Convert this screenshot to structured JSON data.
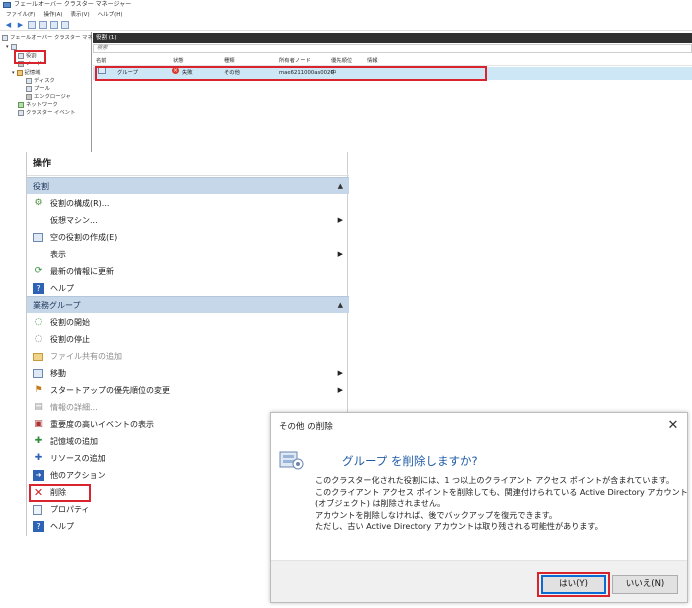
{
  "window": {
    "title": "フェールオーバー クラスター マネージャー",
    "menu": [
      "ファイル(F)",
      "操作(A)",
      "表示(V)",
      "ヘルプ(H)"
    ]
  },
  "tree": {
    "root": "フェールオーバー クラスター マネージャー",
    "cluster": "",
    "items": [
      "役割",
      "ノード",
      "記憶域",
      "ディスク",
      "プール",
      "エンクロージャ",
      "ネットワーク",
      "クラスター イベント"
    ]
  },
  "roles_pane": {
    "header": "役割 (1)",
    "search_placeholder": "検索",
    "columns": [
      "名前",
      "状態",
      "種類",
      "所有者ノード",
      "優先順位",
      "情報"
    ],
    "rows": [
      {
        "name": "グループ",
        "status": "失敗",
        "type": "その他",
        "owner": "mae6211000as0020",
        "priority": "中",
        "info": ""
      }
    ]
  },
  "actions_panel": {
    "title": "操作",
    "section_roles": "役割",
    "roles_items": [
      {
        "icon": "configure-role-icon",
        "label": "役割の構成(R)...",
        "submenu": false,
        "disabled": false
      },
      {
        "icon": "",
        "label": "仮想マシン...",
        "submenu": true,
        "disabled": false
      },
      {
        "icon": "empty-role-icon",
        "label": "空の役割の作成(E)",
        "submenu": false,
        "disabled": false
      },
      {
        "icon": "",
        "label": "表示",
        "submenu": true,
        "disabled": false
      },
      {
        "icon": "refresh-icon",
        "label": "最新の情報に更新",
        "submenu": false,
        "disabled": false
      },
      {
        "icon": "help-icon",
        "label": "ヘルプ",
        "submenu": false,
        "disabled": false
      }
    ],
    "section_group": "業務グループ",
    "group_items": [
      {
        "icon": "start-role-icon",
        "label": "役割の開始",
        "submenu": false,
        "disabled": false
      },
      {
        "icon": "stop-role-icon",
        "label": "役割の停止",
        "submenu": false,
        "disabled": false
      },
      {
        "icon": "file-share-icon",
        "label": "ファイル共有の追加",
        "submenu": false,
        "disabled": true
      },
      {
        "icon": "move-icon",
        "label": "移動",
        "submenu": true,
        "disabled": false
      },
      {
        "icon": "startup-priority-icon",
        "label": "スタートアップの優先順位の変更",
        "submenu": true,
        "disabled": false
      },
      {
        "icon": "info-icon",
        "label": "情報の詳細...",
        "submenu": false,
        "disabled": true
      },
      {
        "icon": "critical-events-icon",
        "label": "重要度の高いイベントの表示",
        "submenu": false,
        "disabled": false
      },
      {
        "icon": "add-storage-icon",
        "label": "記憶域の追加",
        "submenu": false,
        "disabled": false
      },
      {
        "icon": "add-resource-icon",
        "label": "リソースの追加",
        "submenu": true,
        "disabled": false
      },
      {
        "icon": "more-actions-icon",
        "label": "他のアクション",
        "submenu": true,
        "disabled": false
      },
      {
        "icon": "delete-icon",
        "label": "削除",
        "submenu": false,
        "disabled": false
      },
      {
        "icon": "properties-icon",
        "label": "プロパティ",
        "submenu": false,
        "disabled": false
      },
      {
        "icon": "help-icon",
        "label": "ヘルプ",
        "submenu": false,
        "disabled": false
      }
    ]
  },
  "dialog": {
    "title": "その他 の削除",
    "question": "グループ を削除しますか?",
    "body_lines": [
      "このクラスター化された役割には、1 つ以上のクライアント アクセス ポイントが含まれています。",
      "このクライアント アクセス ポイントを削除しても、関連付けられている Active Directory アカウント",
      "(オブジェクト) は削除されません。",
      "アカウントを削除しなければ、後でバックアップを復元できます。",
      "ただし、古い Active Directory アカウントは取り残される可能性があります。"
    ],
    "yes_label": "はい(Y)",
    "no_label": "いいえ(N)"
  },
  "colors": {
    "highlight": "#d9232d",
    "selection": "#cde7f7",
    "section_bg": "#c7d7ea",
    "pane_header": "#303030",
    "question_text": "#1f5aa6"
  }
}
